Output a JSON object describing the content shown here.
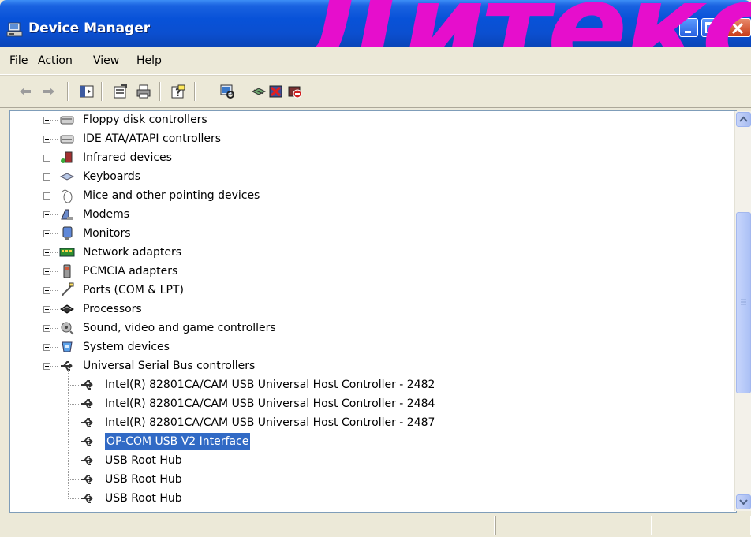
{
  "window": {
    "title": "Device Manager",
    "watermark": "Дитекс"
  },
  "menu": {
    "items": [
      {
        "label": "File",
        "mnemonic": "F",
        "rest": "ile"
      },
      {
        "label": "Action",
        "mnemonic": "A",
        "rest": "ction"
      },
      {
        "label": "View",
        "mnemonic": "V",
        "rest": "iew"
      },
      {
        "label": "Help",
        "mnemonic": "H",
        "rest": "elp"
      }
    ]
  },
  "toolbar": {
    "buttons": [
      "back-arrow-icon",
      "forward-arrow-icon",
      "show-hide-console-tree-icon",
      "properties-icon",
      "print-icon",
      "help-icon",
      "scan-hardware-icon",
      "update-driver-icon",
      "uninstall-icon",
      "disable-icon"
    ]
  },
  "tree": {
    "categories": [
      {
        "label": "Floppy disk controllers",
        "icon": "floppy-controller-icon"
      },
      {
        "label": "IDE ATA/ATAPI controllers",
        "icon": "ide-controller-icon"
      },
      {
        "label": "Infrared devices",
        "icon": "infrared-icon"
      },
      {
        "label": "Keyboards",
        "icon": "keyboard-icon"
      },
      {
        "label": "Mice and other pointing devices",
        "icon": "mouse-icon"
      },
      {
        "label": "Modems",
        "icon": "modem-icon"
      },
      {
        "label": "Monitors",
        "icon": "monitor-icon"
      },
      {
        "label": "Network adapters",
        "icon": "network-adapter-icon"
      },
      {
        "label": "PCMCIA adapters",
        "icon": "pcmcia-icon"
      },
      {
        "label": "Ports (COM & LPT)",
        "icon": "port-icon"
      },
      {
        "label": "Processors",
        "icon": "processor-icon"
      },
      {
        "label": "Sound, video and game controllers",
        "icon": "sound-icon"
      },
      {
        "label": "System devices",
        "icon": "system-device-icon"
      },
      {
        "label": "Universal Serial Bus controllers",
        "icon": "usb-icon"
      }
    ],
    "usb_children": [
      {
        "label": "Intel(R) 82801CA/CAM USB Universal Host Controller - 2482"
      },
      {
        "label": "Intel(R) 82801CA/CAM USB Universal Host Controller - 2484"
      },
      {
        "label": "Intel(R) 82801CA/CAM USB Universal Host Controller - 2487"
      },
      {
        "label": "OP-COM USB V2 Interface",
        "selected": true
      },
      {
        "label": "USB Root Hub"
      },
      {
        "label": "USB Root Hub"
      },
      {
        "label": "USB Root Hub"
      }
    ]
  },
  "colors": {
    "titlebar": "#0852d8",
    "selection": "#316ac5",
    "watermark": "#e60ecc"
  }
}
